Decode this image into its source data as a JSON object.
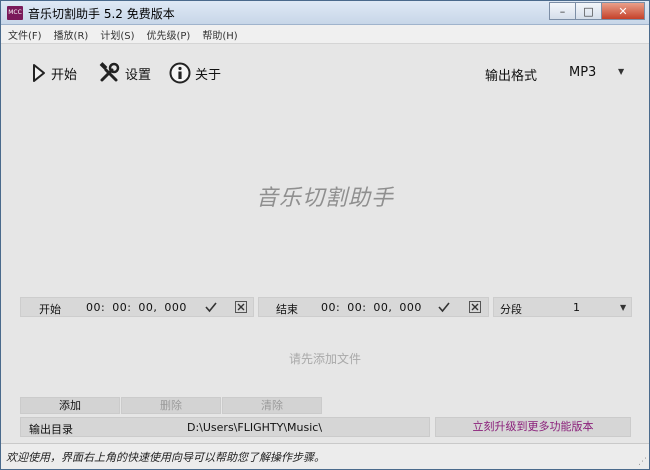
{
  "window": {
    "title": "音乐切割助手 5.2 免费版本",
    "icon_text": "MCC",
    "controls": {
      "minimize": "–",
      "maximize": "□",
      "close": "✕"
    }
  },
  "menu": {
    "items": [
      "文件(F)",
      "播放(R)",
      "计划(S)",
      "优先级(P)",
      "帮助(H)"
    ]
  },
  "toolbar": {
    "start_label": "开始",
    "settings_label": "设置",
    "about_label": "关于",
    "format_label": "输出格式",
    "format_value": "MP3",
    "dropdown_arrow": "▼"
  },
  "watermark": "音乐切割助手",
  "start_segment": {
    "label": "开始",
    "time": "00: 00: 00, 000"
  },
  "end_segment": {
    "label": "结束",
    "time": "00: 00: 00, 000"
  },
  "split": {
    "label": "分段",
    "value": "1",
    "dropdown_arrow": "▼"
  },
  "placeholder": "请先添加文件",
  "buttons": {
    "add": "添加",
    "delete": "删除",
    "clear": "清除"
  },
  "output": {
    "label": "输出目录",
    "path": "D:\\Users\\FLIGHTY\\Music\\"
  },
  "upgrade_link": "立刻升级到更多功能版本",
  "status": "欢迎使用，界面右上角的快速使用向导可以帮助您了解操作步骤。",
  "colors": {
    "accent_link": "#8a1f7a",
    "window_bg": "#e6e6e6"
  }
}
